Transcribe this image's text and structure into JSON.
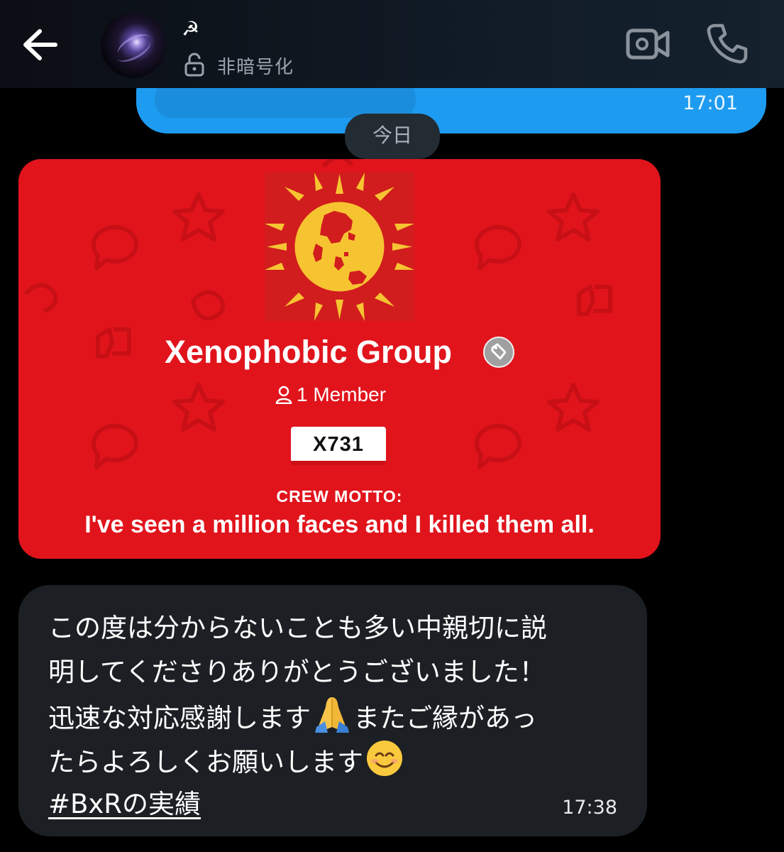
{
  "header": {
    "contact_name": "☭",
    "encryption_status": "非暗号化"
  },
  "conversation": {
    "sent_message": {
      "time": "17:01"
    },
    "date_separator": "今日",
    "group_card": {
      "name": "Xenophobic Group",
      "member_count": "1 Member",
      "tag": "X731",
      "motto_label": "CREW MOTTO:",
      "motto": "I've seen a million faces and I killed them all.",
      "background_color": "#e1141c",
      "emblem_colors": {
        "background": "#d11d1d",
        "sun": "#f6c431"
      }
    },
    "received_message": {
      "line1": "この度は分からないことも多い中親切に説",
      "line2": "明してくださりありがとうございました！",
      "line3a": "迅速な対応感謝します",
      "line3b": "またご縁があっ",
      "line4": "たらよろしくお願いします",
      "hashtag": "#BxR",
      "tail": "の実績",
      "time": "17:38",
      "emoji1": "folded-hands-emoji",
      "emoji2": "smiling-face-emoji"
    }
  },
  "colors": {
    "accent_blue": "#1d9bf0",
    "received_bubble": "#1c2024",
    "background": "#000000"
  }
}
